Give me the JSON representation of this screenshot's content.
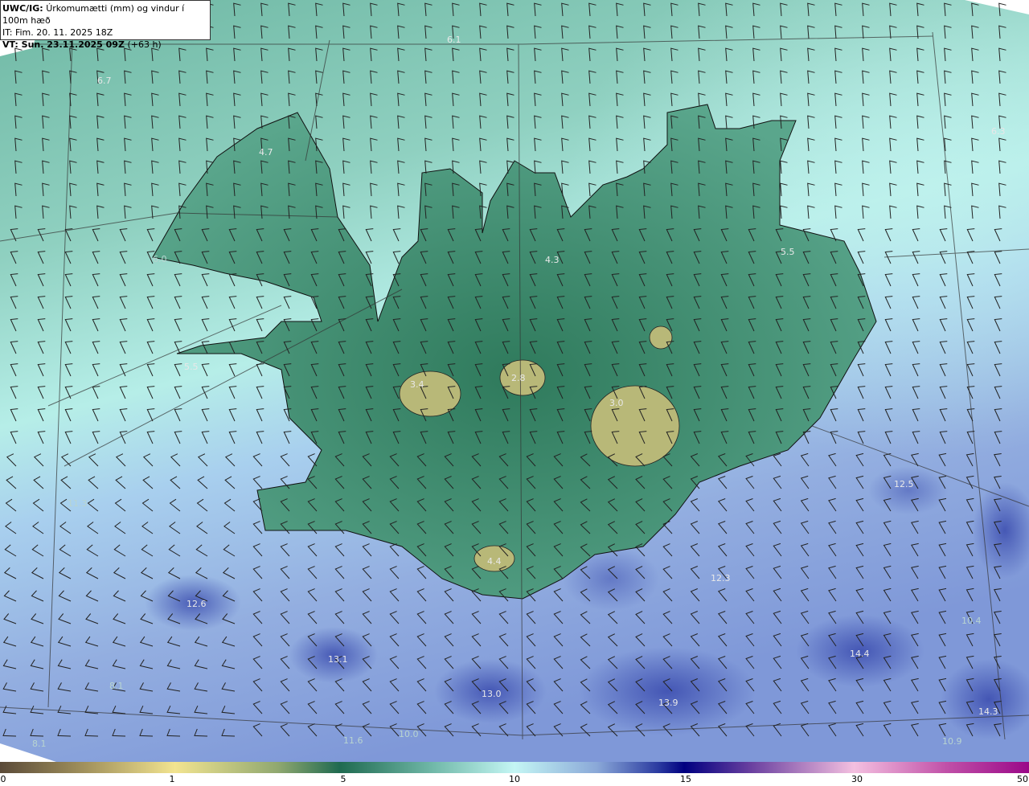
{
  "header": {
    "product": "UWC/IG:",
    "title": "Úrkomumætti (mm) og vindur í 100m hæð",
    "init_time": "IT: Fim. 20. 11. 2025 18Z",
    "valid_prefix": "VT: Sun. 23.11.2025 09Z",
    "valid_suffix": "(+63 h)"
  },
  "colorbar": {
    "ticks": [
      "0",
      "1",
      "5",
      "10",
      "15",
      "30",
      "50"
    ],
    "colors": {
      "low": "#5a4a38",
      "yellow": "#f2e490",
      "green": "#1f6a50",
      "cyan": "#c4f6f4",
      "navy": "#000080",
      "pink": "#f4c0e0",
      "magenta": "#9a0888"
    }
  },
  "map_labels": [
    "6.1",
    "6.7",
    "4.7",
    "6.3",
    "4.3",
    "5.5",
    "5.5",
    "3.4",
    "2.8",
    "3.0",
    "4.4",
    "12.5",
    "12.3",
    "12.6",
    "13.1",
    "13.0",
    "13.9",
    "14.4",
    "14.3",
    "11.3",
    "8.1",
    "8.1",
    "11.6",
    "10.0",
    "10.4",
    "10.9",
    "6.0"
  ]
}
